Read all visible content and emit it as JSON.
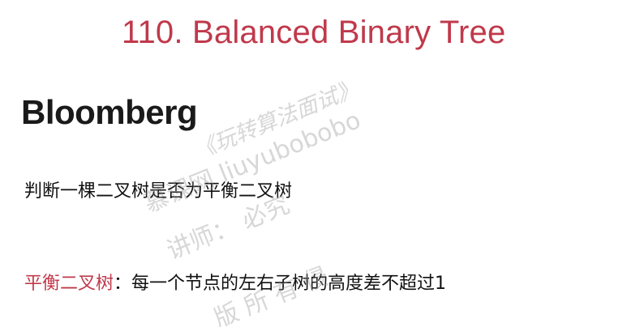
{
  "slide": {
    "title": "110. Balanced Binary Tree",
    "company": "Bloomberg",
    "question": "判断一棵二叉树是否为平衡二叉树",
    "definition": {
      "term": "平衡二叉树",
      "separator": "：",
      "body": "每一个节点的左右子树的高度差不超过1"
    }
  },
  "watermark": {
    "line1": "《玩转算法面试》",
    "line2": "慕课网    liuyubobobo",
    "line3": "讲师：            必究",
    "line4": "版  所  有  侵"
  }
}
